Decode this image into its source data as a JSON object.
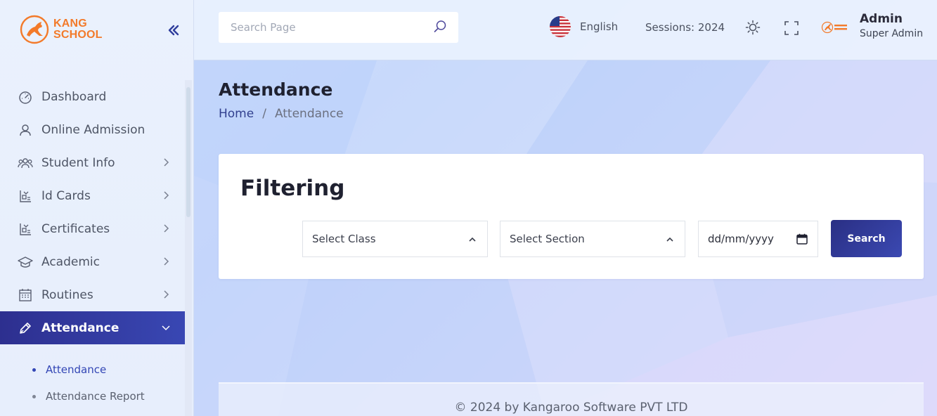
{
  "brand": {
    "line1": "KANG",
    "line2": "SCHOOL",
    "color": "#f37a2a",
    "icon": "kangaroo-logo-icon"
  },
  "sidebar": {
    "collapse_icon": "double-chevron-left-icon",
    "items": [
      {
        "label": "Dashboard",
        "icon": "speedometer-icon",
        "has_children": false
      },
      {
        "label": "Online Admission",
        "icon": "user-icon",
        "has_children": false
      },
      {
        "label": "Student Info",
        "icon": "users-group-icon",
        "has_children": true
      },
      {
        "label": "Id Cards",
        "icon": "id-card-icon",
        "has_children": true
      },
      {
        "label": "Certificates",
        "icon": "certificate-icon",
        "has_children": true
      },
      {
        "label": "Academic",
        "icon": "graduation-cap-icon",
        "has_children": true
      },
      {
        "label": "Routines",
        "icon": "calendar-icon",
        "has_children": true
      },
      {
        "label": "Attendance",
        "icon": "pen-icon",
        "has_children": true,
        "active": true,
        "expanded": true
      }
    ],
    "sub_items": [
      {
        "label": "Attendance",
        "current": true
      },
      {
        "label": "Attendance Report",
        "current": false
      }
    ]
  },
  "topbar": {
    "search": {
      "placeholder": "Search Page",
      "value": "",
      "icon": "search-icon"
    },
    "language": {
      "label": "English",
      "icon": "us-flag-icon"
    },
    "session": {
      "label": "Sessions: 2024"
    },
    "theme_icon": "sun-icon",
    "fullscreen_icon": "fullscreen-icon",
    "user": {
      "name": "Admin",
      "role": "Super Admin",
      "avatar": "school-logo-avatar"
    }
  },
  "page": {
    "title": "Attendance",
    "breadcrumb": {
      "home": "Home",
      "separator": "/",
      "current": "Attendance"
    }
  },
  "filter": {
    "title": "Filtering",
    "class_select": {
      "selected": "Select Class"
    },
    "section_select": {
      "selected": "Select Section"
    },
    "date_input": {
      "value": "dd/mm/yyyy"
    },
    "search_button": "Search"
  },
  "footer": {
    "text": "© 2024 by Kangaroo Software PVT LTD"
  },
  "colors": {
    "accent": "#2f3d9c",
    "brand": "#f37a2a",
    "active_nav": "#3346b5"
  }
}
